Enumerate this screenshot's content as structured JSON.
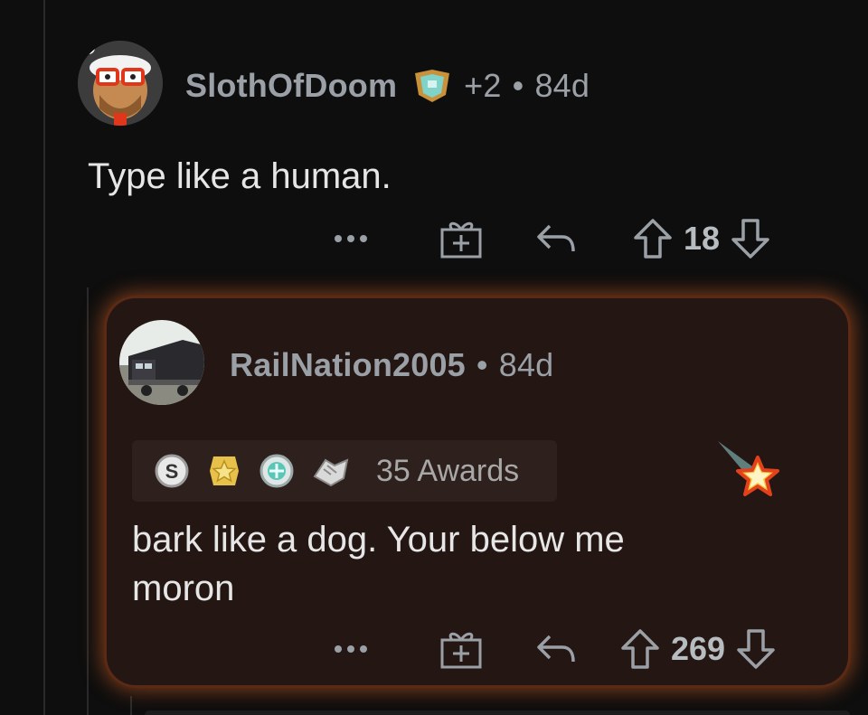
{
  "comment": {
    "username": "SlothOfDoom",
    "flair_extra": "+2",
    "age": "84d",
    "body": "Type like a human.",
    "votes": "18",
    "more_label": "•••"
  },
  "reply": {
    "username": "RailNation2005",
    "age": "84d",
    "awards_label": "35 Awards",
    "body_line1": "bark like a dog. Your below me",
    "body_line2": "moron",
    "votes": "269",
    "more_label": "•••"
  },
  "separator": "•",
  "colors": {
    "glow": "#d6602a",
    "card": "#231613",
    "background": "#0e0e0e"
  },
  "icons": [
    "gift-icon",
    "reply-icon",
    "upvote-icon",
    "downvote-icon",
    "more-icon"
  ]
}
